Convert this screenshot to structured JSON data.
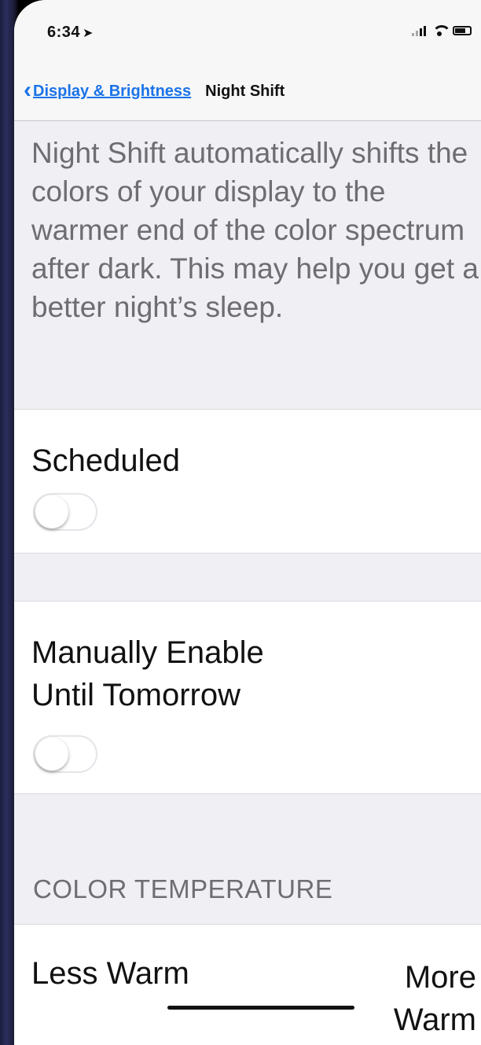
{
  "status_bar": {
    "time": "6:34",
    "location_glyph": "➤",
    "icons": [
      "signal-icon",
      "wifi-icon",
      "battery-icon"
    ]
  },
  "nav": {
    "back_label": "Display & Brightness",
    "title": "Night Shift",
    "accent_color": "#1a73e8"
  },
  "description": "Night Shift automatically shifts the colors of your display to the warmer end of the color spectrum after dark. This may help you get a better night’s sleep.",
  "settings": {
    "scheduled": {
      "label": "Scheduled",
      "enabled": false
    },
    "manual": {
      "label_line1": "Manually Enable",
      "label_line2": "Until Tomorrow",
      "enabled": false
    }
  },
  "color_temperature": {
    "header": "COLOR TEMPERATURE",
    "less_label": "Less Warm",
    "more_label_line1": "More",
    "more_label_line2": "Warm"
  }
}
